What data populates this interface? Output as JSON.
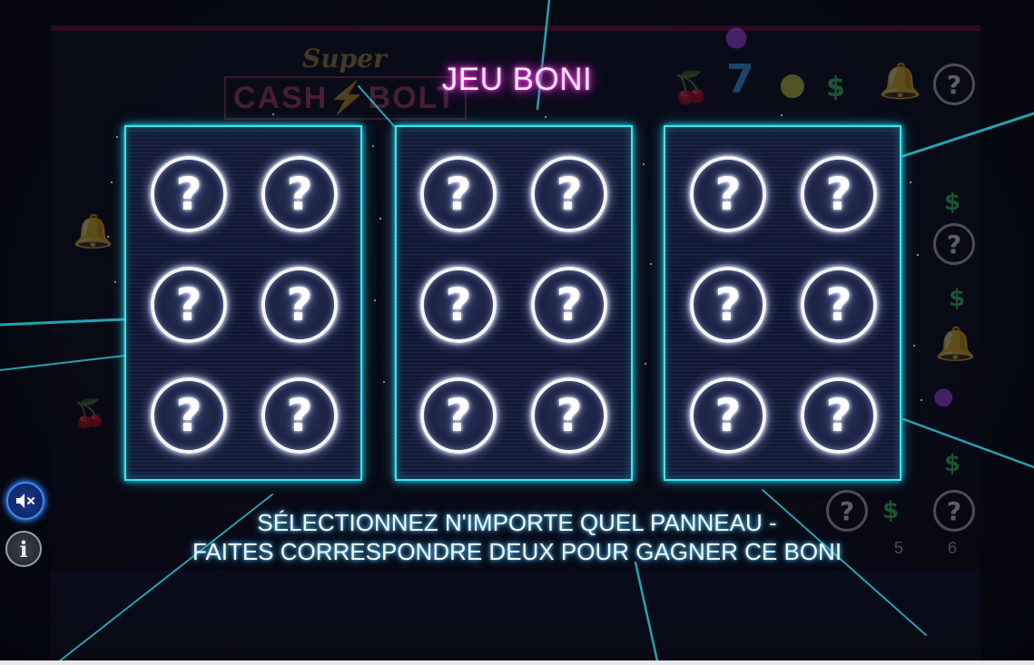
{
  "title": "JEU BONI",
  "panels": [
    {
      "cells": [
        "?",
        "?",
        "?",
        "?",
        "?",
        "?"
      ]
    },
    {
      "cells": [
        "?",
        "?",
        "?",
        "?",
        "?",
        "?"
      ]
    },
    {
      "cells": [
        "?",
        "?",
        "?",
        "?",
        "?",
        "?"
      ]
    }
  ],
  "instructions": {
    "line1": "SÉLECTIONNEZ N'IMPORTE QUEL PANNEAU -",
    "line2": "FAITES CORRESPONDRE DEUX POUR GAGNER CE BONI"
  },
  "background": {
    "logo_top": "Super",
    "logo_main": "CASH⚡BOLT",
    "reel_numbers": [
      "5",
      "6"
    ],
    "mystery_symbol": "?"
  },
  "controls": {
    "sound_icon": "speaker-muted-icon",
    "info_label": "i"
  },
  "colors": {
    "panel_border": "#38e7f2",
    "title_glow": "#e02fd8",
    "ray_color": "#2fd6e6",
    "background": "#05060f"
  }
}
